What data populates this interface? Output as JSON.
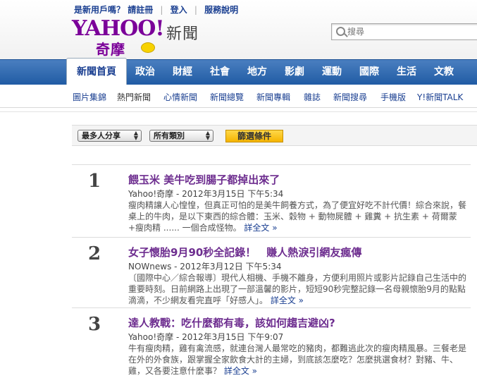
{
  "top_links": {
    "new_user": "是新用戶嗎？",
    "register": "請註冊",
    "login": "登入",
    "help": "服務說明"
  },
  "logo": {
    "main": "YAHOO!",
    "sub": "奇摩",
    "brand_news": "新聞"
  },
  "search": {
    "placeholder": "搜尋"
  },
  "nav": {
    "items": [
      "新聞首頁",
      "政治",
      "財經",
      "社會",
      "地方",
      "影劇",
      "運動",
      "國際",
      "生活",
      "文教"
    ],
    "active_index": 0
  },
  "subnav": {
    "items": [
      "圖片集錦",
      "熱門新聞",
      "心情新聞",
      "新聞總覽",
      "新聞專輯",
      "雜誌",
      "新聞搜尋",
      "手機版",
      "Y!新聞TALK"
    ],
    "current_index": 1
  },
  "filter": {
    "sort_value": "最多人分享",
    "category_value": "所有類別",
    "button_label": "篩選條件"
  },
  "more_label": "詳全文 »",
  "articles": [
    {
      "rank": "1",
      "title": "餵玉米 美牛吃到腸子都掉出來了",
      "source_date": "Yahoo!奇摩 - 2012年3月15日 下午5:34",
      "summary": "瘦肉精讓人心惶惶，但真正可怕的是美牛飼養方式，為了便宜好吃不計代價！綜合來說，餐桌上的牛肉，是以下東西的綜合體：玉米、穀物 + 動物屍體 + 雞糞 + 抗生素 + 荷爾蒙+瘦肉精 ...... 一個合成怪物。"
    },
    {
      "rank": "2",
      "title": "女子懷胎9月90秒全記錄！　賺人熱淚引網友瘋傳",
      "source_date": "NOWnews - 2012年3月12日 下午5:34",
      "summary": "〔國際中心／綜合報導〕現代人相機、手機不離身，方便利用照片或影片記錄自己生活中的重要時刻。日前網路上出現了一部溫馨的影片，短短90秒完整記錄一名母親懷胎9月的點點滴滴，不少網友看完直呼「好感人」。"
    },
    {
      "rank": "3",
      "title": "達人教戰：吃什麼都有毒，該如何趨吉避凶?",
      "source_date": "Yahoo!奇摩 - 2012年3月15日 下午9:07",
      "summary": "牛有瘦肉精，雞有禽流感，就連台灣人最常吃的豬肉，都難逃此次的瘦肉精風暴。三餐老是在外的外食族，跟掌握全家飲食大計的主婦，到底該怎麼吃？怎麼挑選食材？對豬、牛、雞，又各要注意什麼事？"
    }
  ],
  "colors": {
    "nav_blue": "#2b66ad",
    "link_blue": "#1a3f91",
    "headline_purple": "#6d2d8f",
    "logo_purple": "#7b0099",
    "button_yellow": "#f5c21b"
  }
}
